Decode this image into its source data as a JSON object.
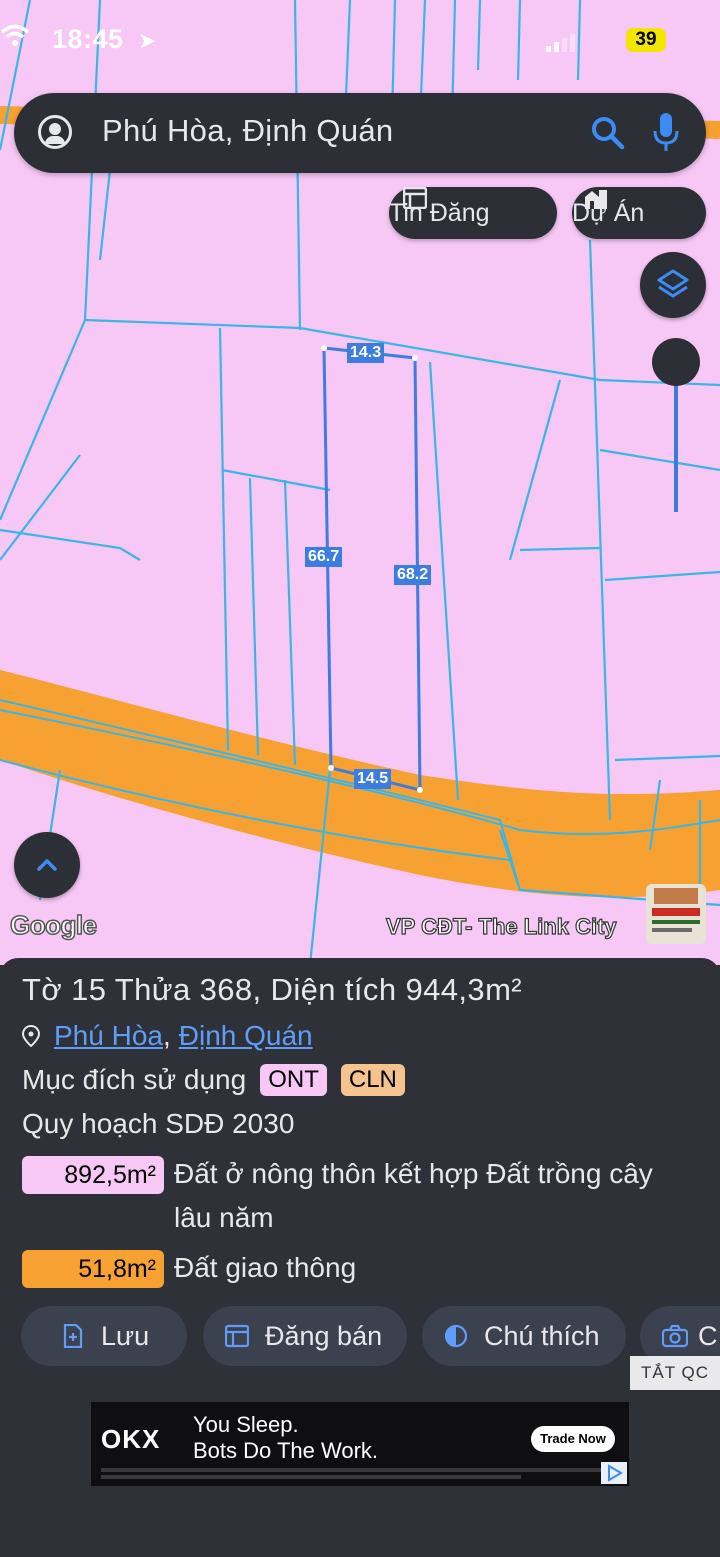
{
  "status_bar": {
    "time": "18:45",
    "battery": "39"
  },
  "search": {
    "query": "Phú Hòa, Định Quán"
  },
  "chips": {
    "listings": "Tin Đăng",
    "projects": "Dự Án"
  },
  "map": {
    "dimensions": {
      "top": "14.3",
      "left": "66.7",
      "right": "68.2",
      "bottom": "14.5"
    },
    "attribution": "Google",
    "watermark": "VP CĐT- The Link City"
  },
  "parcel": {
    "title": "Tờ 15 Thửa 368, Diện tích 944,3m²",
    "address_ward": "Phú Hòa",
    "address_sep": ",",
    "address_district": "Định Quán",
    "purpose_label": "Mục đích sử dụng",
    "purpose_tags": [
      "ONT",
      "CLN"
    ],
    "plan_label": "Quy hoạch SDĐ 2030",
    "zones": [
      {
        "area": "892,5m²",
        "desc": "Đất ở nông thôn kết hợp Đất trồng cây lâu năm",
        "color": "#f7c8f6"
      },
      {
        "area": "51,8m²",
        "desc": "Đất giao thông",
        "color": "#f7a133"
      }
    ]
  },
  "actions": {
    "save": "Lưu",
    "post": "Đăng bán",
    "legend": "Chú thích",
    "capture": "C"
  },
  "ads": {
    "close_label": "TẮT QC",
    "brand": "OKX",
    "line1": "You Sleep.",
    "line2": "Bots Do The Work.",
    "cta": "Trade Now"
  },
  "colors": {
    "map_land": "#f7c8f6",
    "road": "#f7a133",
    "parcel_line": "#3b7de0",
    "panel": "#2f3138",
    "link": "#5f9df7"
  }
}
